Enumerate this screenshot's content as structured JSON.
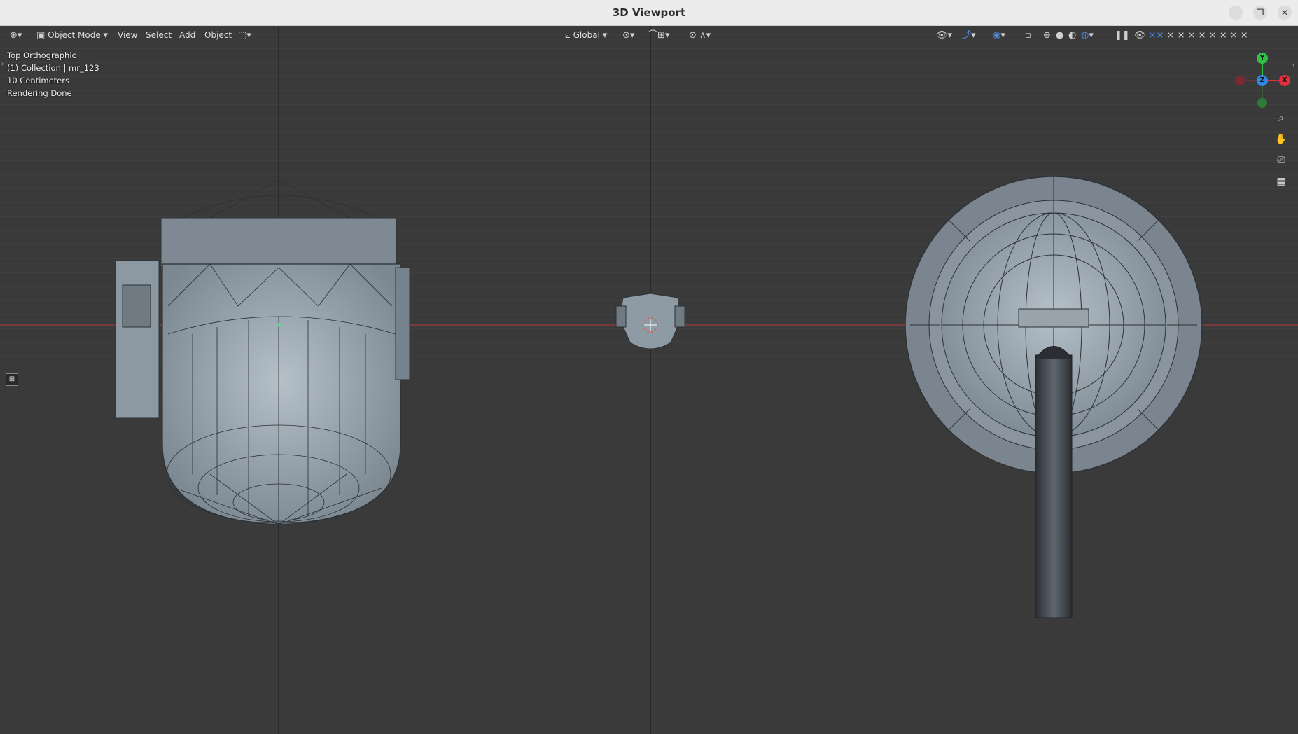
{
  "window": {
    "title": "3D Viewport",
    "controls": [
      "minimize-icon",
      "restore-icon",
      "close-icon"
    ]
  },
  "header": {
    "editor_type_icon": "editor-type-icon",
    "mode_label": "Object Mode",
    "menus": [
      "View",
      "Select",
      "Add",
      "Object"
    ],
    "transform_orientation": "Global"
  },
  "overlay_info": {
    "view_name": "Top Orthographic",
    "collection": "(1) Collection | mr_123",
    "grid_scale": "10 Centimeters",
    "status": "Rendering Done"
  },
  "gizmo": {
    "y_label": "Y",
    "x_label": "X",
    "z_label": "Z",
    "colors": {
      "x": "#e0313f",
      "y": "#2ec245",
      "z": "#2f87e6"
    }
  },
  "navigation": [
    "zoom-icon",
    "pan-hand-icon",
    "camera-icon",
    "grid-toggle-icon"
  ],
  "colors": {
    "viewport_bg": "#3a3a3a",
    "grid_line": "#444444",
    "x_axis": "#8a3d3d",
    "y_axis": "#222222",
    "accent": "#4b8ee8"
  }
}
